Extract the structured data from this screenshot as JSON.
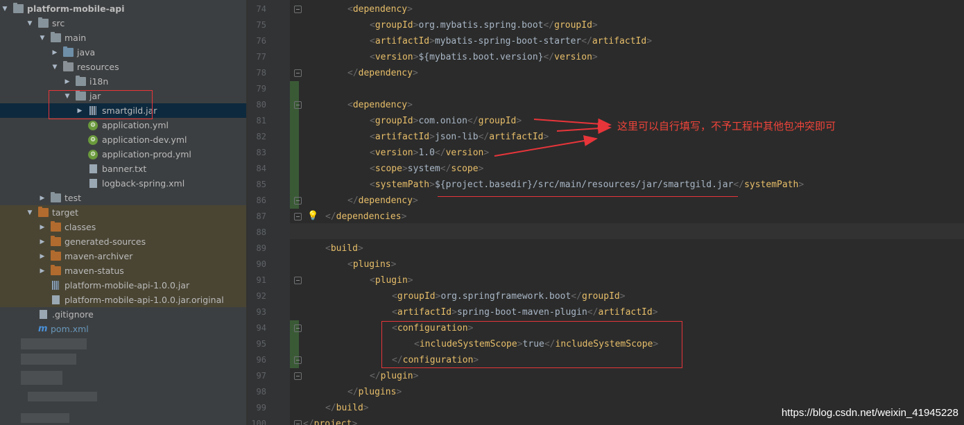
{
  "project": {
    "root": "platform-mobile-api",
    "items": [
      {
        "label": "platform-mobile-api",
        "icon": "folder-icon",
        "expand": "down",
        "indent": 0,
        "style": "bold"
      },
      {
        "label": "src",
        "icon": "folder-icon",
        "expand": "down",
        "indent": 1
      },
      {
        "label": "main",
        "icon": "folder-icon",
        "expand": "down",
        "indent": 2
      },
      {
        "label": "java",
        "icon": "source-folder-icon",
        "expand": "right",
        "indent": 3
      },
      {
        "label": "resources",
        "icon": "resources-folder-icon",
        "expand": "down",
        "indent": 3
      },
      {
        "label": "i18n",
        "icon": "folder-icon",
        "expand": "right",
        "indent": 4
      },
      {
        "label": "jar",
        "icon": "folder-icon",
        "expand": "down",
        "indent": 4
      },
      {
        "label": "smartgild.jar",
        "icon": "jar-icon",
        "expand": "right",
        "indent": 5,
        "selected": true
      },
      {
        "label": "application.yml",
        "icon": "spring-config-icon",
        "expand": "none",
        "indent": 5
      },
      {
        "label": "application-dev.yml",
        "icon": "spring-config-icon",
        "expand": "none",
        "indent": 5
      },
      {
        "label": "application-prod.yml",
        "icon": "spring-config-icon",
        "expand": "none",
        "indent": 5
      },
      {
        "label": "banner.txt",
        "icon": "text-file-icon",
        "expand": "none",
        "indent": 5
      },
      {
        "label": "logback-spring.xml",
        "icon": "xml-file-icon",
        "expand": "none",
        "indent": 5
      },
      {
        "label": "test",
        "icon": "folder-icon",
        "expand": "right",
        "indent": 2
      },
      {
        "label": "target",
        "icon": "excluded-folder-icon",
        "expand": "down",
        "indent": 1,
        "target": true
      },
      {
        "label": "classes",
        "icon": "excluded-folder-icon",
        "expand": "right",
        "indent": 2,
        "target": true
      },
      {
        "label": "generated-sources",
        "icon": "excluded-folder-icon",
        "expand": "right",
        "indent": 2,
        "target": true
      },
      {
        "label": "maven-archiver",
        "icon": "excluded-folder-icon",
        "expand": "right",
        "indent": 2,
        "target": true
      },
      {
        "label": "maven-status",
        "icon": "excluded-folder-icon",
        "expand": "right",
        "indent": 2,
        "target": true
      },
      {
        "label": "platform-mobile-api-1.0.0.jar",
        "icon": "jar-icon",
        "expand": "none",
        "indent": 2,
        "target": true
      },
      {
        "label": "platform-mobile-api-1.0.0.jar.original",
        "icon": "unknown-file-icon",
        "expand": "none",
        "indent": 2,
        "target": true
      },
      {
        "label": ".gitignore",
        "icon": "text-file-icon",
        "expand": "none",
        "indent": 1
      },
      {
        "label": "pom.xml",
        "icon": "maven-icon",
        "expand": "none",
        "indent": 1,
        "style": "blue"
      }
    ]
  },
  "editor": {
    "file": "pom.xml",
    "lines": [
      {
        "n": "74",
        "indent": 2,
        "tokens": [
          [
            "b",
            "<"
          ],
          [
            "t",
            "dependency"
          ],
          [
            "b",
            ">"
          ]
        ]
      },
      {
        "n": "75",
        "indent": 3,
        "tokens": [
          [
            "b",
            "<"
          ],
          [
            "t",
            "groupId"
          ],
          [
            "b",
            ">"
          ],
          [
            "x",
            "org.mybatis.spring.boot"
          ],
          [
            "b",
            "</"
          ],
          [
            "t",
            "groupId"
          ],
          [
            "b",
            ">"
          ]
        ]
      },
      {
        "n": "76",
        "indent": 3,
        "tokens": [
          [
            "b",
            "<"
          ],
          [
            "t",
            "artifactId"
          ],
          [
            "b",
            ">"
          ],
          [
            "x",
            "mybatis-spring-boot-starter"
          ],
          [
            "b",
            "</"
          ],
          [
            "t",
            "artifactId"
          ],
          [
            "b",
            ">"
          ]
        ]
      },
      {
        "n": "77",
        "indent": 3,
        "tokens": [
          [
            "b",
            "<"
          ],
          [
            "t",
            "version"
          ],
          [
            "b",
            ">"
          ],
          [
            "x",
            "${mybatis.boot.version}"
          ],
          [
            "b",
            "</"
          ],
          [
            "t",
            "version"
          ],
          [
            "b",
            ">"
          ]
        ]
      },
      {
        "n": "78",
        "indent": 2,
        "tokens": [
          [
            "b",
            "</"
          ],
          [
            "t",
            "dependency"
          ],
          [
            "b",
            ">"
          ]
        ]
      },
      {
        "n": "79",
        "indent": 0,
        "tokens": []
      },
      {
        "n": "80",
        "indent": 2,
        "tokens": [
          [
            "b",
            "<"
          ],
          [
            "t",
            "dependency"
          ],
          [
            "b",
            ">"
          ]
        ]
      },
      {
        "n": "81",
        "indent": 3,
        "tokens": [
          [
            "b",
            "<"
          ],
          [
            "t",
            "groupId"
          ],
          [
            "b",
            ">"
          ],
          [
            "x",
            "com.onion"
          ],
          [
            "b",
            "</"
          ],
          [
            "t",
            "groupId"
          ],
          [
            "b",
            ">"
          ]
        ]
      },
      {
        "n": "82",
        "indent": 3,
        "tokens": [
          [
            "b",
            "<"
          ],
          [
            "t",
            "artifactId"
          ],
          [
            "b",
            ">"
          ],
          [
            "x",
            "json-lib"
          ],
          [
            "b",
            "</"
          ],
          [
            "t",
            "artifactId"
          ],
          [
            "b",
            ">"
          ]
        ]
      },
      {
        "n": "83",
        "indent": 3,
        "tokens": [
          [
            "b",
            "<"
          ],
          [
            "t",
            "version"
          ],
          [
            "b",
            ">"
          ],
          [
            "x",
            "1.0"
          ],
          [
            "b",
            "</"
          ],
          [
            "t",
            "version"
          ],
          [
            "b",
            ">"
          ]
        ]
      },
      {
        "n": "84",
        "indent": 3,
        "tokens": [
          [
            "b",
            "<"
          ],
          [
            "t",
            "scope"
          ],
          [
            "b",
            ">"
          ],
          [
            "x",
            "system"
          ],
          [
            "b",
            "</"
          ],
          [
            "t",
            "scope"
          ],
          [
            "b",
            ">"
          ]
        ]
      },
      {
        "n": "85",
        "indent": 3,
        "tokens": [
          [
            "b",
            "<"
          ],
          [
            "t",
            "systemPath"
          ],
          [
            "b",
            ">"
          ],
          [
            "x",
            "${project.basedir}/src/main/resources/jar/smartgild.jar"
          ],
          [
            "b",
            "</"
          ],
          [
            "t",
            "systemPath"
          ],
          [
            "b",
            ">"
          ]
        ]
      },
      {
        "n": "86",
        "indent": 2,
        "tokens": [
          [
            "b",
            "</"
          ],
          [
            "t",
            "dependency"
          ],
          [
            "b",
            ">"
          ]
        ]
      },
      {
        "n": "87",
        "indent": 1,
        "tokens": [
          [
            "b",
            "</"
          ],
          [
            "t",
            "dependencies"
          ],
          [
            "b",
            ">"
          ]
        ]
      },
      {
        "n": "88",
        "indent": 0,
        "tokens": []
      },
      {
        "n": "89",
        "indent": 1,
        "tokens": [
          [
            "b",
            "<"
          ],
          [
            "t",
            "build"
          ],
          [
            "b",
            ">"
          ]
        ]
      },
      {
        "n": "90",
        "indent": 2,
        "tokens": [
          [
            "b",
            "<"
          ],
          [
            "t",
            "plugins"
          ],
          [
            "b",
            ">"
          ]
        ]
      },
      {
        "n": "91",
        "indent": 3,
        "tokens": [
          [
            "b",
            "<"
          ],
          [
            "t",
            "plugin"
          ],
          [
            "b",
            ">"
          ]
        ]
      },
      {
        "n": "92",
        "indent": 4,
        "tokens": [
          [
            "b",
            "<"
          ],
          [
            "t",
            "groupId"
          ],
          [
            "b",
            ">"
          ],
          [
            "x",
            "org.springframework.boot"
          ],
          [
            "b",
            "</"
          ],
          [
            "t",
            "groupId"
          ],
          [
            "b",
            ">"
          ]
        ]
      },
      {
        "n": "93",
        "indent": 4,
        "tokens": [
          [
            "b",
            "<"
          ],
          [
            "t",
            "artifactId"
          ],
          [
            "b",
            ">"
          ],
          [
            "x",
            "spring-boot-maven-plugin"
          ],
          [
            "b",
            "</"
          ],
          [
            "t",
            "artifactId"
          ],
          [
            "b",
            ">"
          ]
        ]
      },
      {
        "n": "94",
        "indent": 4,
        "tokens": [
          [
            "b",
            "<"
          ],
          [
            "t",
            "configuration"
          ],
          [
            "b",
            ">"
          ]
        ]
      },
      {
        "n": "95",
        "indent": 5,
        "tokens": [
          [
            "b",
            "<"
          ],
          [
            "t",
            "includeSystemScope"
          ],
          [
            "b",
            ">"
          ],
          [
            "x",
            "true"
          ],
          [
            "b",
            "</"
          ],
          [
            "t",
            "includeSystemScope"
          ],
          [
            "b",
            ">"
          ]
        ]
      },
      {
        "n": "96",
        "indent": 4,
        "tokens": [
          [
            "b",
            "</"
          ],
          [
            "t",
            "configuration"
          ],
          [
            "b",
            ">"
          ]
        ]
      },
      {
        "n": "97",
        "indent": 3,
        "tokens": [
          [
            "b",
            "</"
          ],
          [
            "t",
            "plugin"
          ],
          [
            "b",
            ">"
          ]
        ]
      },
      {
        "n": "98",
        "indent": 2,
        "tokens": [
          [
            "b",
            "</"
          ],
          [
            "t",
            "plugins"
          ],
          [
            "b",
            ">"
          ]
        ]
      },
      {
        "n": "99",
        "indent": 1,
        "tokens": [
          [
            "b",
            "</"
          ],
          [
            "t",
            "build"
          ],
          [
            "b",
            ">"
          ]
        ]
      },
      {
        "n": "100",
        "indent": 0,
        "tokens": [
          [
            "b",
            "</"
          ],
          [
            "t",
            "project"
          ],
          [
            "b",
            ">"
          ]
        ]
      }
    ],
    "fold_lines": [
      "74",
      "78",
      "80",
      "86",
      "87",
      "91",
      "94",
      "96",
      "97",
      "100"
    ],
    "changed_lines": [
      "79",
      "80",
      "81",
      "82",
      "83",
      "84",
      "85",
      "86",
      "94",
      "95",
      "96"
    ],
    "current_line": "88"
  },
  "annotation": {
    "text": "这里可以自行填写，不予工程中其他包冲突即可",
    "color": "#f0443a"
  },
  "watermark": "https://blog.csdn.net/weixin_41945228",
  "colors": {
    "tag": "#e8bf6a",
    "bracket": "#6a6a6a",
    "text": "#a9b7c6",
    "highlight_box": "#e8353a"
  }
}
